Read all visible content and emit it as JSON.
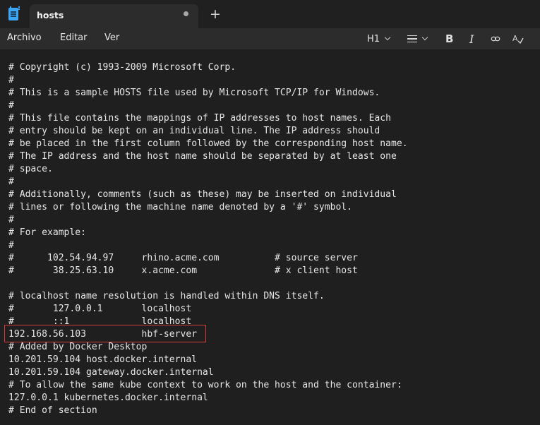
{
  "tab": {
    "title": "hosts"
  },
  "menu": {
    "items": [
      "Archivo",
      "Editar",
      "Ver"
    ]
  },
  "toolbar": {
    "heading_label": "H1"
  },
  "document": {
    "lines": [
      "# Copyright (c) 1993-2009 Microsoft Corp.",
      "#",
      "# This is a sample HOSTS file used by Microsoft TCP/IP for Windows.",
      "#",
      "# This file contains the mappings of IP addresses to host names. Each",
      "# entry should be kept on an individual line. The IP address should",
      "# be placed in the first column followed by the corresponding host name.",
      "# The IP address and the host name should be separated by at least one",
      "# space.",
      "#",
      "# Additionally, comments (such as these) may be inserted on individual",
      "# lines or following the machine name denoted by a '#' symbol.",
      "#",
      "# For example:",
      "#",
      "#      102.54.94.97     rhino.acme.com          # source server",
      "#       38.25.63.10     x.acme.com              # x client host",
      "",
      "# localhost name resolution is handled within DNS itself.",
      "#       127.0.0.1       localhost",
      "#       ::1             localhost",
      "192.168.56.103          hbf-server",
      "# Added by Docker Desktop",
      "10.201.59.104 host.docker.internal",
      "10.201.59.104 gateway.docker.internal",
      "# To allow the same kube context to work on the host and the container:",
      "127.0.0.1 kubernetes.docker.internal",
      "# End of section"
    ]
  }
}
